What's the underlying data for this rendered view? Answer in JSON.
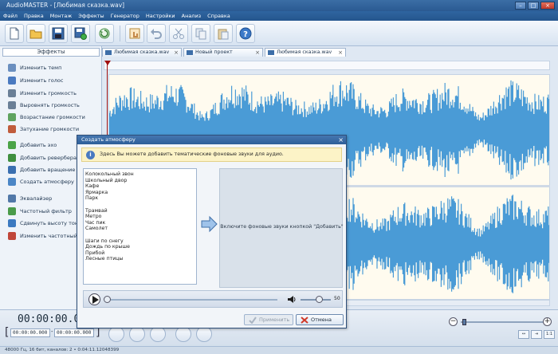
{
  "window": {
    "title": "AudioMASTER - [Любимая сказка.wav]"
  },
  "menu": [
    "Файл",
    "Правка",
    "Монтаж",
    "Эффекты",
    "Генератор",
    "Настройки",
    "Анализ",
    "Справка"
  ],
  "effects_panel": {
    "title": "Эффекты",
    "items": [
      {
        "label": "Изменить темп",
        "icon": "tempo-icon",
        "color": "#6b8fbf"
      },
      {
        "label": "Изменить голос",
        "icon": "voice-icon",
        "color": "#4a7ac0"
      },
      {
        "label": "Изменить громкость",
        "icon": "volume-change-icon",
        "color": "#6a7f96"
      },
      {
        "label": "Выровнять громкость",
        "icon": "volume-level-icon",
        "color": "#6a7f96"
      },
      {
        "label": "Возрастание громкости",
        "icon": "fade-in-icon",
        "color": "#5fa35f"
      },
      {
        "label": "Затухание громкости",
        "icon": "fade-out-icon",
        "color": "#c05c3c"
      },
      {
        "label": "Добавить эхо",
        "icon": "echo-icon",
        "color": "#4aa347"
      },
      {
        "label": "Добавить реверберацию",
        "icon": "reverb-icon",
        "color": "#3f8f3f"
      },
      {
        "label": "Добавить вращение ко",
        "icon": "rotate-icon",
        "color": "#3a6fb0"
      },
      {
        "label": "Создать атмосферу",
        "icon": "atmosphere-icon",
        "color": "#4b86c6"
      },
      {
        "label": "Эквалайзер",
        "icon": "equalizer-icon",
        "color": "#5178a8"
      },
      {
        "label": "Частотный фильтр",
        "icon": "filter-icon",
        "color": "#4a9b4a"
      },
      {
        "label": "Сдвинуть высоту тона",
        "icon": "pitch-icon",
        "color": "#3b79c0"
      },
      {
        "label": "Изменить частотный сп",
        "icon": "spectrum-icon",
        "color": "#c0463a"
      }
    ]
  },
  "tabs": [
    {
      "label": "Любимая сказка.wav",
      "active": false
    },
    {
      "label": "Новый проект",
      "active": false
    },
    {
      "label": "Любимая сказка.wav",
      "active": true
    }
  ],
  "colors": {
    "waveform": "#4a9bd6",
    "wave_bg": "#fffbef",
    "accent": "#2e5f98"
  },
  "transport": {
    "time": "00:00:00.000",
    "sel_start": "00:00:00.000",
    "sel_dash": "-",
    "sel_end": "00:00:00.000",
    "bracket_open": "[",
    "bracket_close": "]"
  },
  "zoom": {
    "minus": "−",
    "plus": "+",
    "fit_label": "1:1"
  },
  "status": "48000 Гц, 16 бит, каналов: 2 • 0:04:11.12048399",
  "dialog": {
    "title": "Создать атмосферу",
    "close": "×",
    "info": "Здесь Вы можете добавить тематические фоновые звуки для аудио.",
    "sounds": [
      "Колокольный звон",
      "Школьный двор",
      "Кафе",
      "Ярмарка",
      "Парк",
      "",
      "Трамвай",
      "Метро",
      "Час пик",
      "Самолет",
      "",
      "Шаги по снегу",
      "Дождь по крыше",
      "Прибой",
      "Лесные птицы"
    ],
    "placeholder": "Включите фоновые звуки кнопкой \"Добавить\"",
    "volume_value": "50",
    "apply": "Применить",
    "cancel": "Отмена"
  }
}
